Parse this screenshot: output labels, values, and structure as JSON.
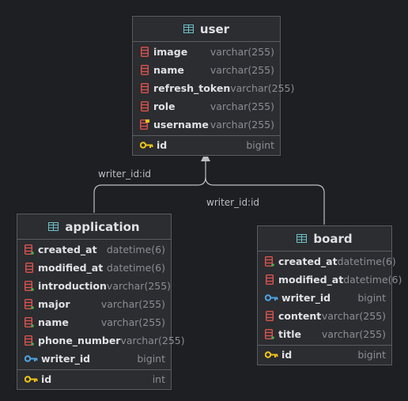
{
  "colors": {
    "background": "#1e1f22",
    "table_bg": "#2b2d30",
    "border": "#5a5d63",
    "column_icon": "#d9534f",
    "key_icon": "#f0c419",
    "fk_icon": "#4ea3e0",
    "edge": "#bcbec4"
  },
  "tables": {
    "user": {
      "title": "user",
      "columns": [
        {
          "name": "image",
          "type": "varchar(255)",
          "icon": "column-icon"
        },
        {
          "name": "name",
          "type": "varchar(255)",
          "icon": "column-icon"
        },
        {
          "name": "refresh_token",
          "type": "varchar(255)",
          "icon": "column-icon"
        },
        {
          "name": "role",
          "type": "varchar(255)",
          "icon": "column-icon"
        },
        {
          "name": "username",
          "type": "varchar(255)",
          "icon": "unique-column-icon"
        }
      ],
      "pk": {
        "name": "id",
        "type": "bigint",
        "icon": "primary-key-icon"
      }
    },
    "application": {
      "title": "application",
      "columns": [
        {
          "name": "created_at",
          "type": "datetime(6)",
          "icon": "column-icon"
        },
        {
          "name": "modified_at",
          "type": "datetime(6)",
          "icon": "column-icon"
        },
        {
          "name": "introduction",
          "type": "varchar(255)",
          "icon": "column-icon"
        },
        {
          "name": "major",
          "type": "varchar(255)",
          "icon": "column-icon"
        },
        {
          "name": "name",
          "type": "varchar(255)",
          "icon": "column-icon"
        },
        {
          "name": "phone_number",
          "type": "varchar(255)",
          "icon": "column-icon"
        },
        {
          "name": "writer_id",
          "type": "bigint",
          "icon": "foreign-key-icon"
        }
      ],
      "pk": {
        "name": "id",
        "type": "int",
        "icon": "primary-key-icon"
      }
    },
    "board": {
      "title": "board",
      "columns": [
        {
          "name": "created_at",
          "type": "datetime(6)",
          "icon": "column-icon"
        },
        {
          "name": "modified_at",
          "type": "datetime(6)",
          "icon": "column-icon"
        },
        {
          "name": "writer_id",
          "type": "bigint",
          "icon": "foreign-key-icon"
        },
        {
          "name": "content",
          "type": "varchar(255)",
          "icon": "column-icon"
        },
        {
          "name": "title",
          "type": "varchar(255)",
          "icon": "column-icon"
        }
      ],
      "pk": {
        "name": "id",
        "type": "bigint",
        "icon": "primary-key-icon"
      }
    }
  },
  "relations": [
    {
      "label": "writer_id:id",
      "from": "application",
      "to": "user"
    },
    {
      "label": "writer_id:id",
      "from": "board",
      "to": "user"
    }
  ]
}
